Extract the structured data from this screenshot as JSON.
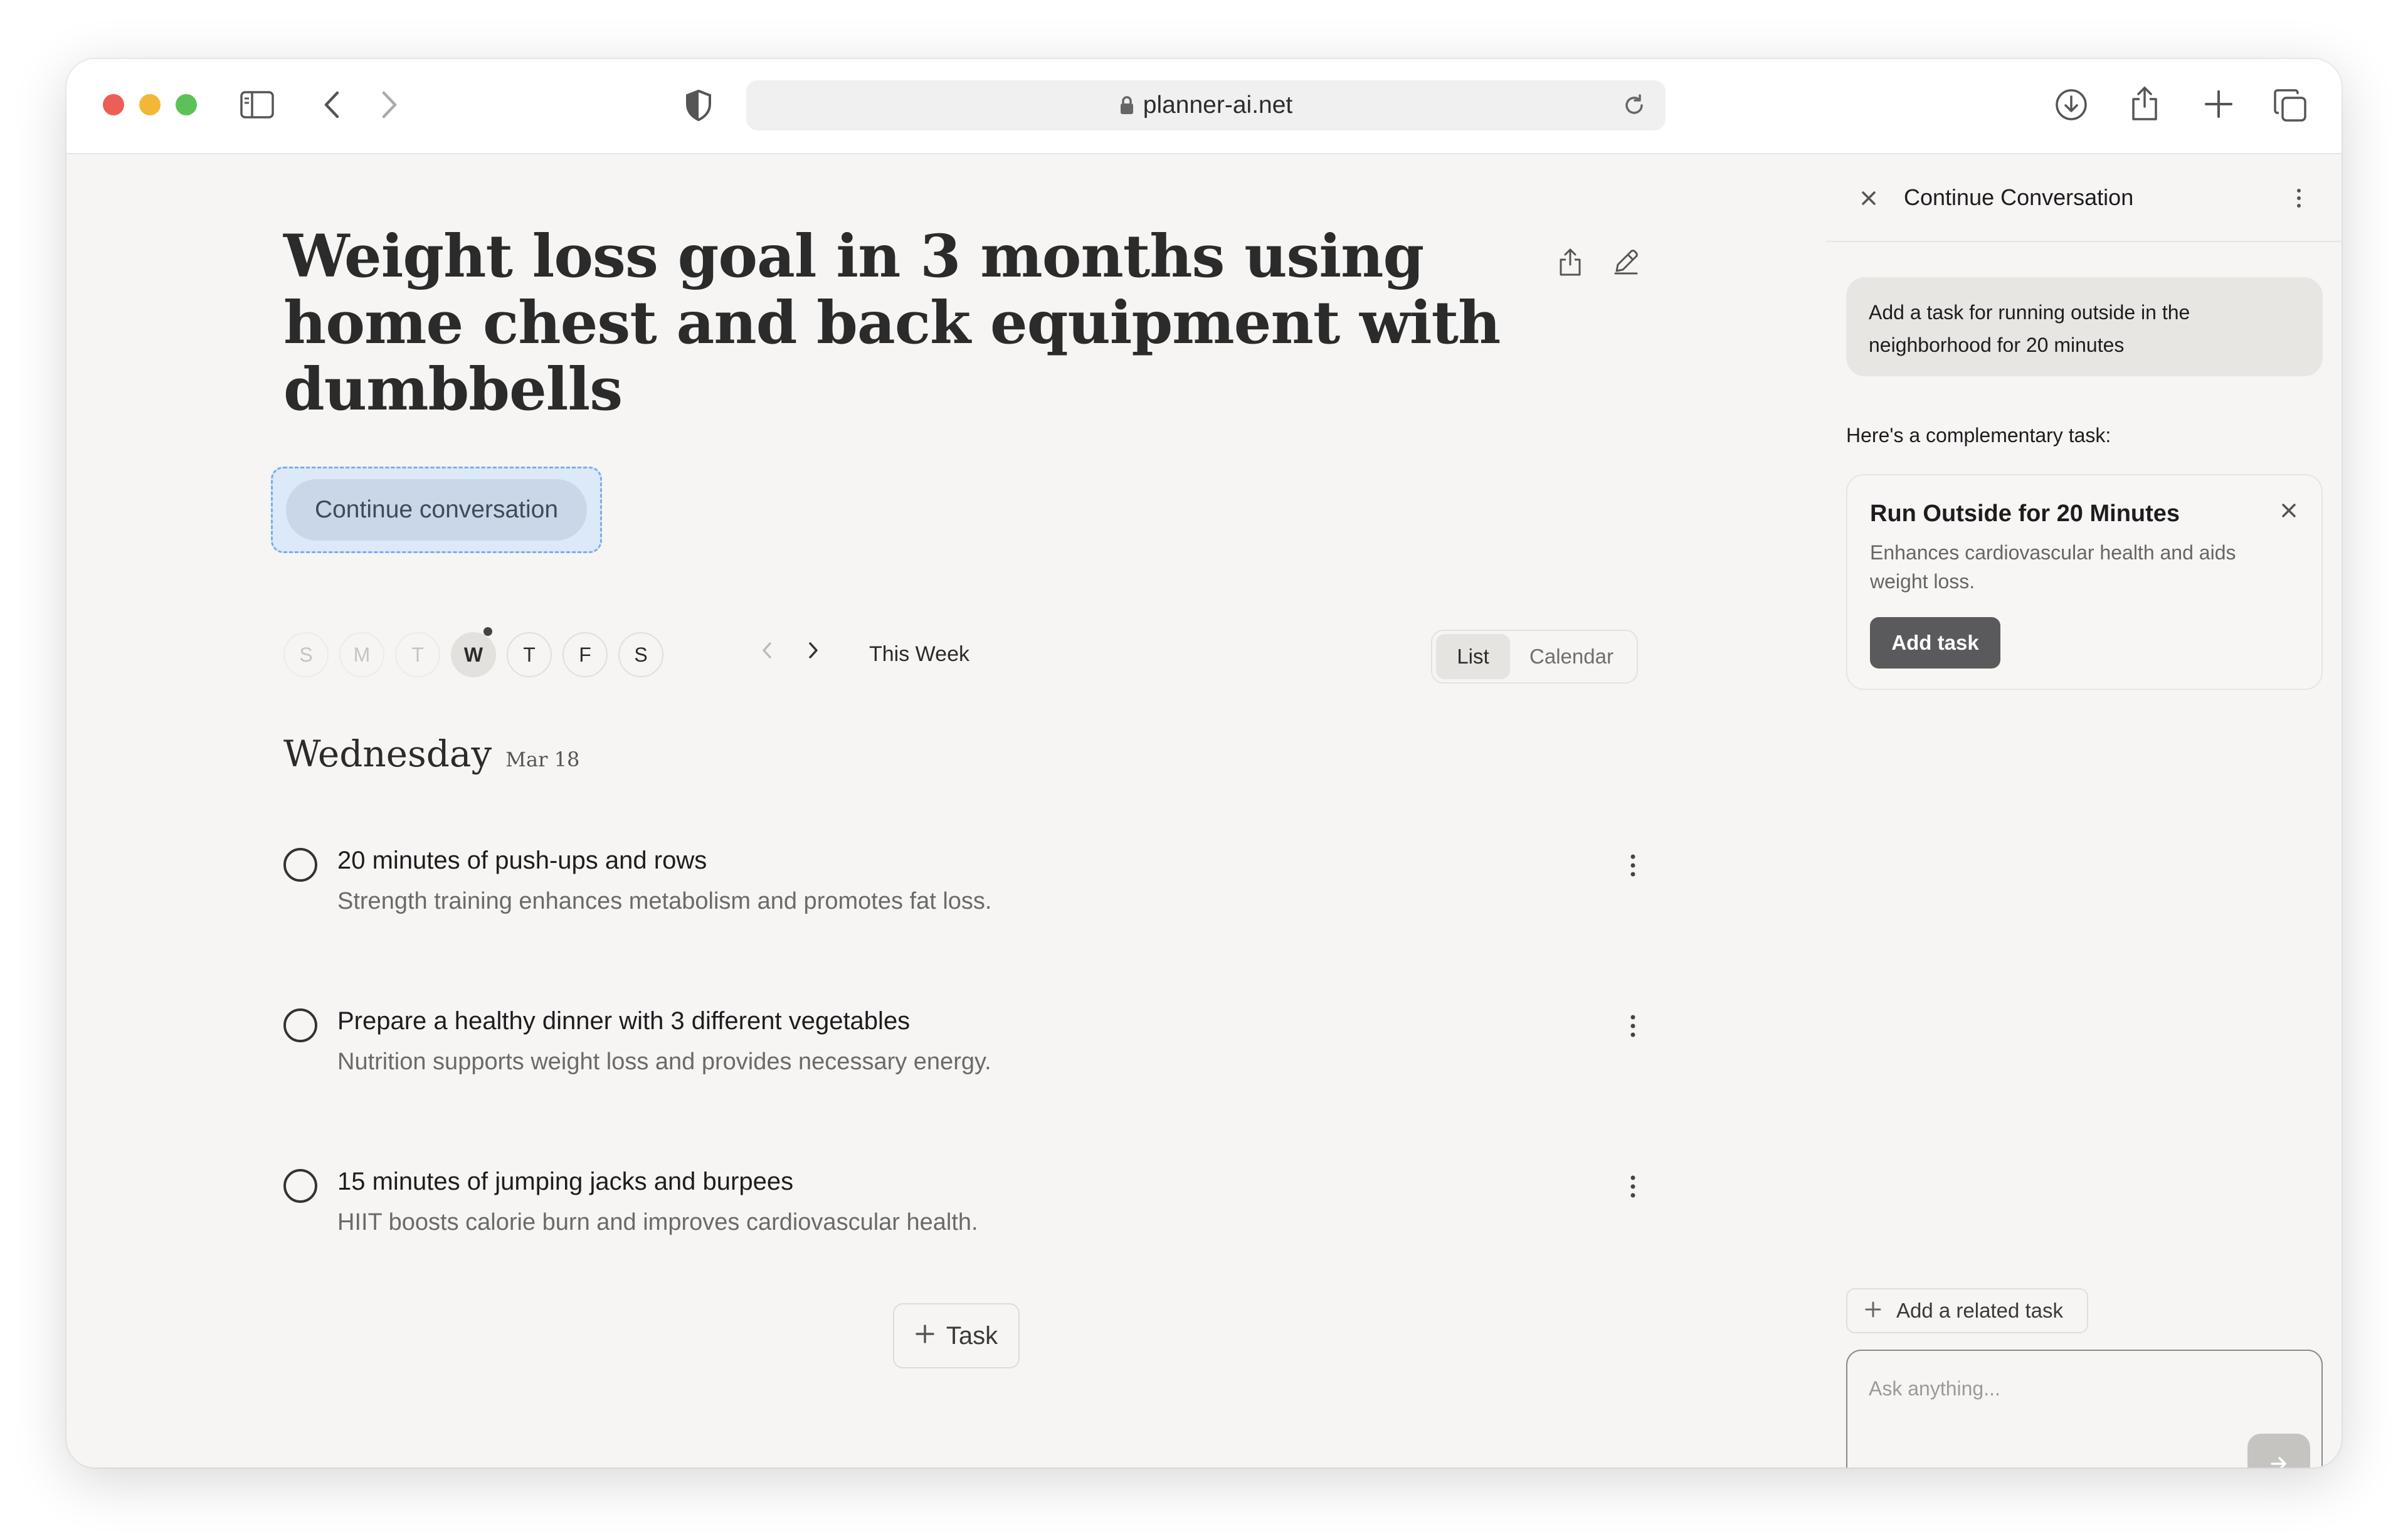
{
  "browser": {
    "url": "planner-ai.net",
    "icons": [
      "sidebar-icon",
      "back-icon",
      "forward-icon",
      "shield-icon",
      "lock-icon",
      "reload-icon",
      "download-icon",
      "share-icon",
      "new-tab-icon",
      "tabs-icon"
    ]
  },
  "page": {
    "title": "Weight loss goal in 3 months using home chest and back equipment with dumbbells",
    "continue_label": "Continue conversation"
  },
  "week": {
    "days": [
      "S",
      "M",
      "T",
      "W",
      "T",
      "F",
      "S"
    ],
    "active_index": 3,
    "label": "This Week",
    "view_list": "List",
    "view_calendar": "Calendar"
  },
  "day_section": {
    "name": "Wednesday",
    "date": "Mar 18"
  },
  "tasks": [
    {
      "title": "20 minutes of push-ups and rows",
      "description": "Strength training enhances metabolism and promotes fat loss."
    },
    {
      "title": "Prepare a healthy dinner with 3 different vegetables",
      "description": "Nutrition supports weight loss and provides necessary energy."
    },
    {
      "title": "15 minutes of jumping jacks and burpees",
      "description": "HIIT boosts calorie burn and improves cardiovascular health."
    }
  ],
  "add_task_label": "Task",
  "panel": {
    "title": "Continue Conversation",
    "user_message": "Add a task for running outside in the neighborhood for 20 minutes",
    "assistant_intro": "Here's a complementary task:",
    "suggestion": {
      "title": "Run Outside for 20 Minutes",
      "description": "Enhances cardiovascular health and aids weight loss.",
      "add_label": "Add task"
    },
    "related_label": "Add a related task",
    "input_placeholder": "Ask anything..."
  },
  "colors": {
    "background": "#f6f5f3",
    "continue_button": "#c9d7e8",
    "focus_outline": "#7aaee6",
    "add_task_button": "#5a595c"
  }
}
